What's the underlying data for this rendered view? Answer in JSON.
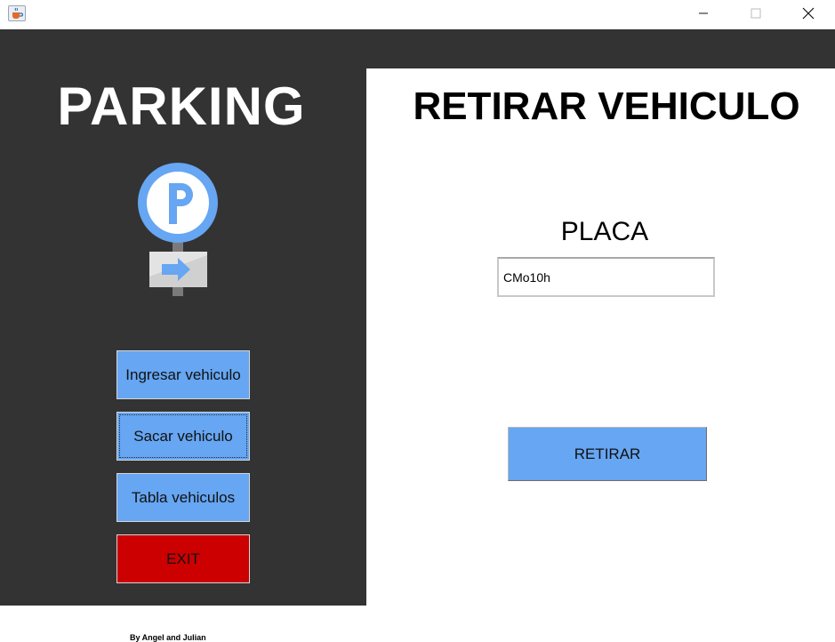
{
  "window": {
    "app_icon": "java-coffee-cup-icon",
    "controls": [
      "minimize-icon",
      "maximize-icon",
      "close-icon"
    ]
  },
  "sidebar": {
    "title": "PARKING",
    "logo_icon": "parking-sign-icon",
    "buttons": [
      {
        "label": "Ingresar vehiculo",
        "color": "#66a6f2"
      },
      {
        "label": "Sacar vehiculo",
        "color": "#66a6f2",
        "selected": true
      },
      {
        "label": "Tabla vehiculos",
        "color": "#66a6f2"
      },
      {
        "label": "EXIT",
        "color": "#cc0000"
      }
    ]
  },
  "main": {
    "title": "RETIRAR VEHICULO",
    "plate_label": "PLACA",
    "plate_value": "CMo10h",
    "submit_label": "RETIRAR"
  },
  "footer": {
    "credit": "By Angel and Julian"
  },
  "colors": {
    "panel_dark": "#333333",
    "accent_blue": "#66a6f2",
    "exit_red": "#cc0000"
  }
}
